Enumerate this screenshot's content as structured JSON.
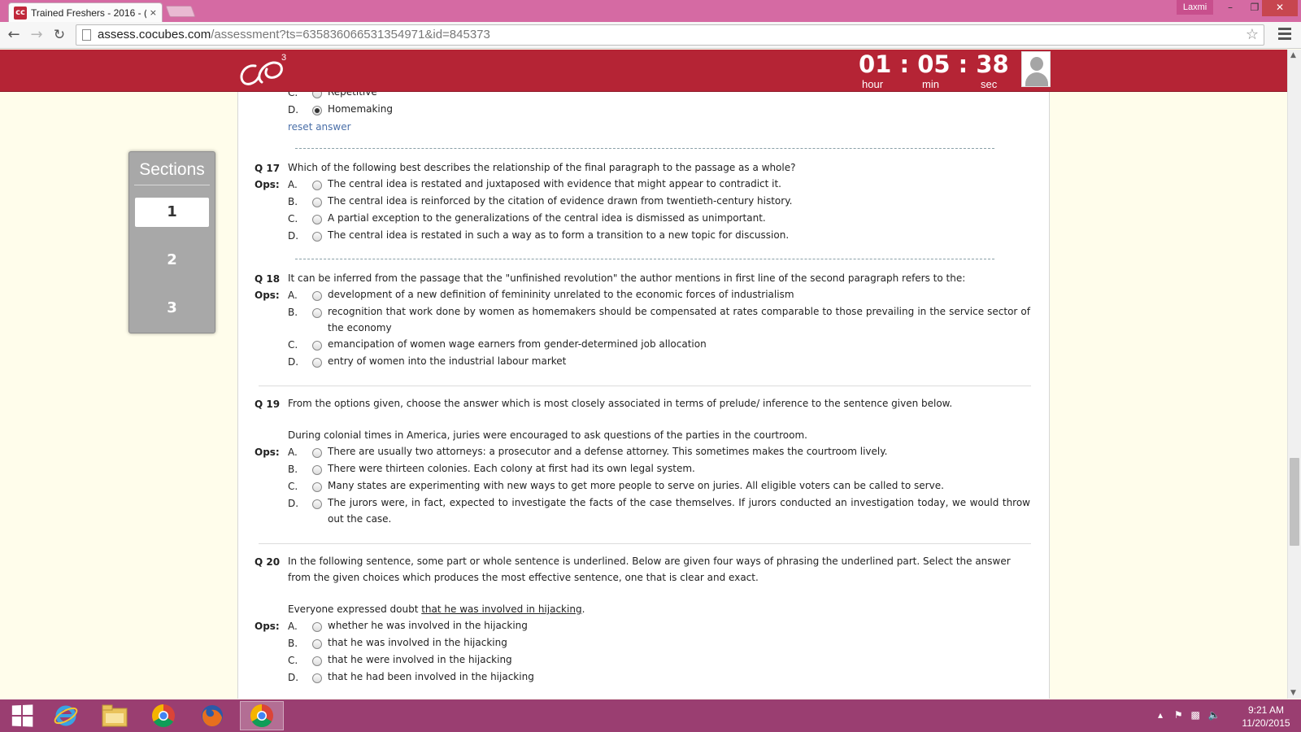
{
  "browser": {
    "tab_title": "Trained Freshers - 2016 - (",
    "tab_close": "×",
    "profile_name": "Laxmi",
    "url_host": "assess.cocubes.com",
    "url_path": "/assessment?ts=635836066531354971&id=845373"
  },
  "header": {
    "logo_superscript": "3",
    "timer": {
      "hours": "01",
      "minutes": "05",
      "seconds": "38",
      "separator": ":",
      "hour_label": "hour",
      "min_label": "min",
      "sec_label": "sec"
    }
  },
  "sections": {
    "title": "Sections",
    "items": [
      {
        "label": "1",
        "active": true
      },
      {
        "label": "2",
        "active": false
      },
      {
        "label": "3",
        "active": false
      }
    ]
  },
  "ops_label": "Ops:",
  "q16_tail": {
    "options": [
      {
        "letter": "C.",
        "text": "Repetitive",
        "checked": false
      },
      {
        "letter": "D.",
        "text": "Homemaking",
        "checked": true
      }
    ],
    "reset_label": "reset answer"
  },
  "questions": [
    {
      "number": "Q 17",
      "text": "Which of the following best describes the relationship of the final paragraph to the passage as a whole?",
      "options": [
        {
          "letter": "A.",
          "text": "The central idea is restated and juxtaposed with evidence that might appear to contradict it."
        },
        {
          "letter": "B.",
          "text": "The central idea is reinforced by the citation of evidence drawn from twentieth-century history."
        },
        {
          "letter": "C.",
          "text": "A partial exception to the generalizations of the central idea is dismissed as unimportant."
        },
        {
          "letter": "D.",
          "text": "The central idea is restated in such a way as to form a transition to a new topic for discussion."
        }
      ]
    },
    {
      "number": "Q 18",
      "text": "It can be inferred from the passage that the \"unfinished revolution\" the author mentions in first line of the second paragraph refers to the:",
      "options": [
        {
          "letter": "A.",
          "text": "development of a new definition of femininity unrelated to the economic forces of industrialism"
        },
        {
          "letter": "B.",
          "text": "recognition that work done by women as homemakers should be compensated at rates comparable to those prevailing in the service sector of the economy"
        },
        {
          "letter": "C.",
          "text": "emancipation of women wage earners from gender-determined job allocation"
        },
        {
          "letter": "D.",
          "text": "entry of women into the industrial labour market"
        }
      ]
    },
    {
      "number": "Q 19",
      "text": "From the options given, choose the answer which is most closely associated in terms of prelude/ inference to the sentence given below.",
      "sentence": "During colonial times in America, juries were encouraged to ask questions of the parties in the courtroom.",
      "options": [
        {
          "letter": "A.",
          "text": "There are usually two attorneys: a prosecutor and a defense attorney. This sometimes makes the courtroom lively."
        },
        {
          "letter": "B.",
          "text": "There were thirteen colonies. Each colony at first had its own legal system."
        },
        {
          "letter": "C.",
          "text": "Many states are experimenting with new ways to get more people to serve on juries. All eligible voters can be called to serve."
        },
        {
          "letter": "D.",
          "text": "The jurors were, in fact, expected to investigate the facts of the case themselves. If jurors conducted an investigation today, we would throw out the case."
        }
      ]
    },
    {
      "number": "Q 20",
      "text": "In the following sentence, some part or whole sentence is underlined. Below are given four ways of phrasing the underlined part. Select the answer from the given choices which produces the most effective sentence, one that is clear and exact.",
      "sentence_prefix": "Everyone expressed doubt ",
      "sentence_underlined": "that he was involved in hijacking",
      "sentence_suffix": ".",
      "options": [
        {
          "letter": "A.",
          "text": "whether he was involved in the hijacking"
        },
        {
          "letter": "B.",
          "text": "that he was involved in the hijacking"
        },
        {
          "letter": "C.",
          "text": "that he were involved in the hijacking"
        },
        {
          "letter": "D.",
          "text": "that he had been involved in the hijacking"
        }
      ]
    }
  ],
  "taskbar": {
    "time": "9:21 AM",
    "date": "11/20/2015",
    "apps": [
      "start-button",
      "internet-explorer",
      "file-explorer",
      "chrome",
      "firefox",
      "chrome-active"
    ]
  },
  "colors": {
    "header_red": "#b52435",
    "titlebar_pink": "#d56aa3",
    "taskbar_purple": "#9a3e71",
    "page_bg": "#fffdeb"
  }
}
